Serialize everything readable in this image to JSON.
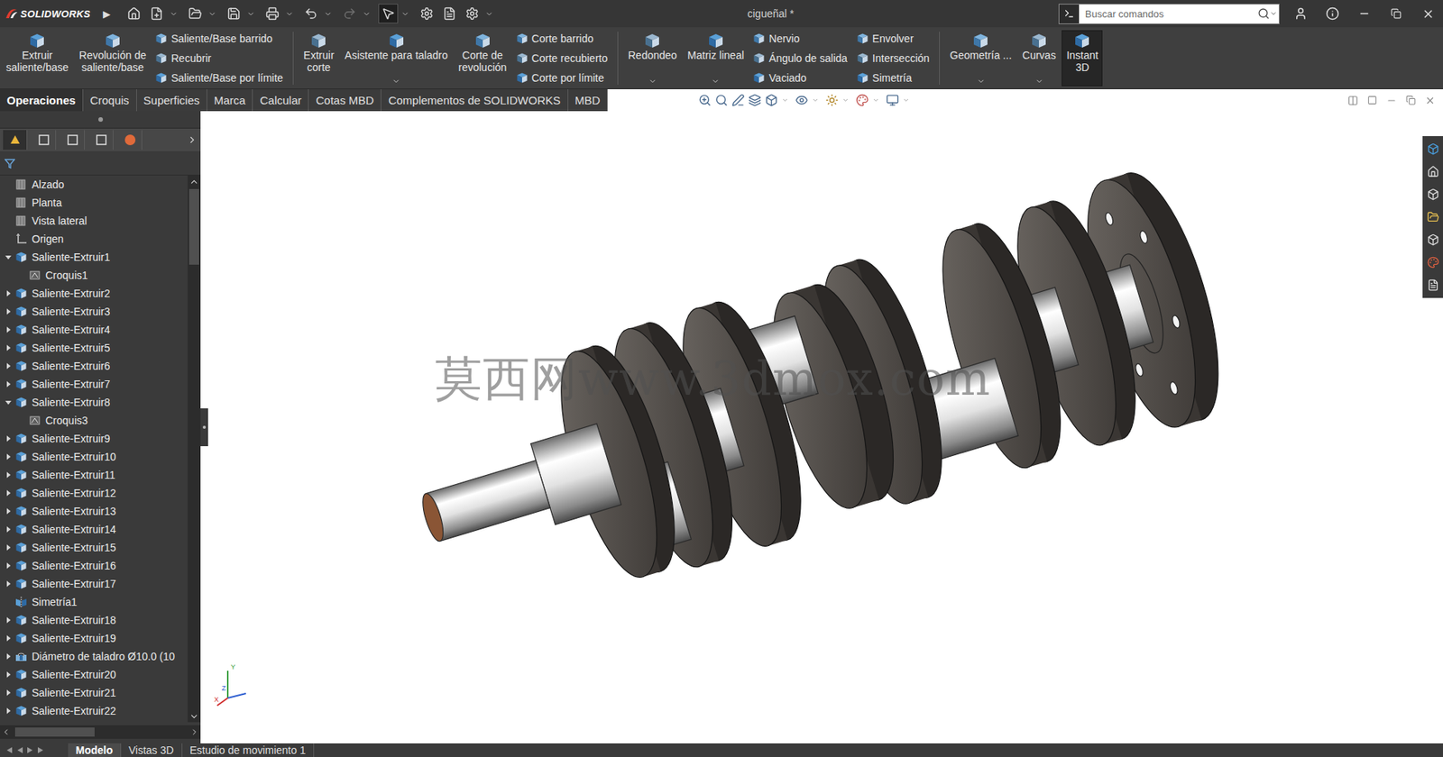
{
  "app": {
    "logo": "SOLIDWORKS",
    "menu_arrow": "▶"
  },
  "window": {
    "title": "cigueñal *"
  },
  "search": {
    "placeholder": "Buscar comandos"
  },
  "ribbon": [
    {
      "items": [
        {
          "kind": "large",
          "lines": [
            "Extruir",
            "saliente/base"
          ],
          "has_menu": false,
          "selected": false
        },
        {
          "kind": "large",
          "lines": [
            "Revolución de",
            "saliente/base"
          ],
          "has_menu": false,
          "selected": false
        },
        {
          "kind": "stack",
          "entries": [
            "Saliente/Base barrido",
            "Recubrir",
            "Saliente/Base por límite"
          ]
        }
      ]
    },
    {
      "items": [
        {
          "kind": "large",
          "lines": [
            "Extruir",
            "corte"
          ],
          "has_menu": false,
          "selected": false
        },
        {
          "kind": "large",
          "lines": [
            "Asistente para taladro"
          ],
          "has_menu": true,
          "selected": false
        },
        {
          "kind": "large",
          "lines": [
            "Corte de",
            "revolución"
          ],
          "has_menu": false,
          "selected": false
        },
        {
          "kind": "stack",
          "entries": [
            "Corte barrido",
            "Corte recubierto",
            "Corte por límite"
          ]
        }
      ]
    },
    {
      "items": [
        {
          "kind": "large",
          "lines": [
            "Redondeo"
          ],
          "has_menu": true,
          "selected": false
        },
        {
          "kind": "large",
          "lines": [
            "Matriz lineal"
          ],
          "has_menu": true,
          "selected": false
        },
        {
          "kind": "stack",
          "entries": [
            "Nervio",
            "Ángulo de salida",
            "Vaciado"
          ]
        },
        {
          "kind": "stack",
          "entries": [
            "Envolver",
            "Intersección",
            "Simetría"
          ]
        }
      ]
    },
    {
      "items": [
        {
          "kind": "large",
          "lines": [
            "Geometría ..."
          ],
          "has_menu": true,
          "selected": false
        },
        {
          "kind": "large",
          "lines": [
            "Curvas"
          ],
          "has_menu": true,
          "selected": false
        },
        {
          "kind": "large",
          "lines": [
            "Instant",
            "3D"
          ],
          "has_menu": false,
          "selected": true
        }
      ]
    }
  ],
  "command_tabs": [
    {
      "label": "Operaciones",
      "selected": true
    },
    {
      "label": "Croquis",
      "selected": false
    },
    {
      "label": "Superficies",
      "selected": false
    },
    {
      "label": "Marca",
      "selected": false
    },
    {
      "label": "Calcular",
      "selected": false
    },
    {
      "label": "Cotas MBD",
      "selected": false
    },
    {
      "label": "Complementos de SOLIDWORKS",
      "selected": false
    },
    {
      "label": "MBD",
      "selected": false
    }
  ],
  "feature_tree": [
    {
      "label": "Alzado",
      "kind": "plane",
      "depth": 0,
      "expandable": false,
      "expanded": false
    },
    {
      "label": "Planta",
      "kind": "plane",
      "depth": 0,
      "expandable": false,
      "expanded": false
    },
    {
      "label": "Vista lateral",
      "kind": "plane",
      "depth": 0,
      "expandable": false,
      "expanded": false
    },
    {
      "label": "Origen",
      "kind": "origin",
      "depth": 0,
      "expandable": false,
      "expanded": false
    },
    {
      "label": "Saliente-Extruir1",
      "kind": "extrude",
      "depth": 0,
      "expandable": true,
      "expanded": true
    },
    {
      "label": "Croquis1",
      "kind": "sketch",
      "depth": 1,
      "expandable": false,
      "expanded": false
    },
    {
      "label": "Saliente-Extruir2",
      "kind": "extrude",
      "depth": 0,
      "expandable": true,
      "expanded": false
    },
    {
      "label": "Saliente-Extruir3",
      "kind": "extrude",
      "depth": 0,
      "expandable": true,
      "expanded": false
    },
    {
      "label": "Saliente-Extruir4",
      "kind": "extrude",
      "depth": 0,
      "expandable": true,
      "expanded": false
    },
    {
      "label": "Saliente-Extruir5",
      "kind": "extrude",
      "depth": 0,
      "expandable": true,
      "expanded": false
    },
    {
      "label": "Saliente-Extruir6",
      "kind": "extrude",
      "depth": 0,
      "expandable": true,
      "expanded": false
    },
    {
      "label": "Saliente-Extruir7",
      "kind": "extrude",
      "depth": 0,
      "expandable": true,
      "expanded": false
    },
    {
      "label": "Saliente-Extruir8",
      "kind": "extrude",
      "depth": 0,
      "expandable": true,
      "expanded": true
    },
    {
      "label": "Croquis3",
      "kind": "sketch",
      "depth": 1,
      "expandable": false,
      "expanded": false
    },
    {
      "label": "Saliente-Extruir9",
      "kind": "extrude",
      "depth": 0,
      "expandable": true,
      "expanded": false
    },
    {
      "label": "Saliente-Extruir10",
      "kind": "extrude",
      "depth": 0,
      "expandable": true,
      "expanded": false
    },
    {
      "label": "Saliente-Extruir11",
      "kind": "extrude",
      "depth": 0,
      "expandable": true,
      "expanded": false
    },
    {
      "label": "Saliente-Extruir12",
      "kind": "extrude",
      "depth": 0,
      "expandable": true,
      "expanded": false
    },
    {
      "label": "Saliente-Extruir13",
      "kind": "extrude",
      "depth": 0,
      "expandable": true,
      "expanded": false
    },
    {
      "label": "Saliente-Extruir14",
      "kind": "extrude",
      "depth": 0,
      "expandable": true,
      "expanded": false
    },
    {
      "label": "Saliente-Extruir15",
      "kind": "extrude",
      "depth": 0,
      "expandable": true,
      "expanded": false
    },
    {
      "label": "Saliente-Extruir16",
      "kind": "extrude",
      "depth": 0,
      "expandable": true,
      "expanded": false
    },
    {
      "label": "Saliente-Extruir17",
      "kind": "extrude",
      "depth": 0,
      "expandable": true,
      "expanded": false
    },
    {
      "label": "Simetría1",
      "kind": "mirror",
      "depth": 0,
      "expandable": false,
      "expanded": false
    },
    {
      "label": "Saliente-Extruir18",
      "kind": "extrude",
      "depth": 0,
      "expandable": true,
      "expanded": false
    },
    {
      "label": "Saliente-Extruir19",
      "kind": "extrude",
      "depth": 0,
      "expandable": true,
      "expanded": false
    },
    {
      "label": "Diámetro de taladro Ø10.0 (10",
      "kind": "hole",
      "depth": 0,
      "expandable": true,
      "expanded": false
    },
    {
      "label": "Saliente-Extruir20",
      "kind": "extrude",
      "depth": 0,
      "expandable": true,
      "expanded": false
    },
    {
      "label": "Saliente-Extruir21",
      "kind": "extrude",
      "depth": 0,
      "expandable": true,
      "expanded": false
    },
    {
      "label": "Saliente-Extruir22",
      "kind": "extrude",
      "depth": 0,
      "expandable": true,
      "expanded": false
    }
  ],
  "viewport": {
    "watermark": "莫西网www.3dmox.com",
    "triad": [
      "Y",
      "Z",
      "X"
    ]
  },
  "bottom_tabs": [
    {
      "label": "Modelo",
      "selected": true
    },
    {
      "label": "Vistas 3D",
      "selected": false
    },
    {
      "label": "Estudio de movimiento 1",
      "selected": false
    }
  ]
}
